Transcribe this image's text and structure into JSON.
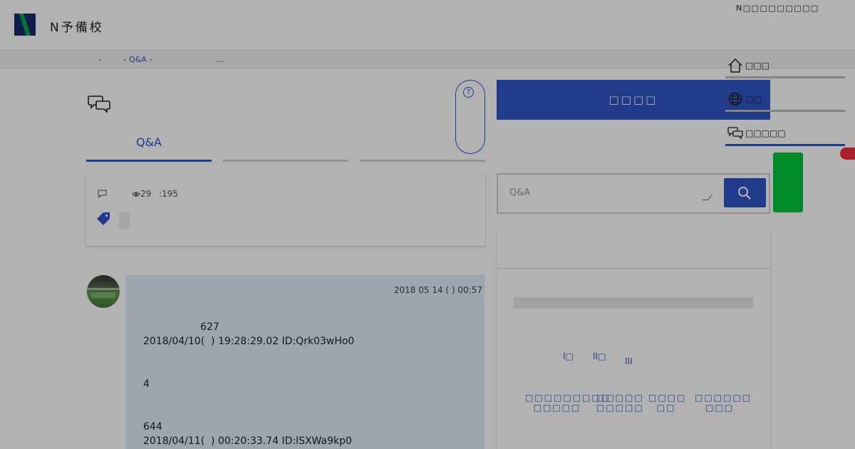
{
  "header": {
    "brand": "N予備校",
    "top_right_text": "N□□□□□□□□□"
  },
  "breadcrumb": {
    "sep1": "-",
    "sep2": "-",
    "link": "Q&A",
    "sep3": "-",
    "ellipsis": "..."
  },
  "help": {
    "icon_glyph": "?"
  },
  "tabs": [
    {
      "label": "Q&A",
      "active": true
    },
    {
      "label": "",
      "active": false
    },
    {
      "label": "",
      "active": false
    }
  ],
  "question_card": {
    "views": "29",
    "count": ":195"
  },
  "post": {
    "date": "2018  05  14  (  ) 00:57",
    "lines": [
      "                  627",
      "2018/04/10(  ) 19:28:29.02 ID:Qrk03wHo0",
      "4",
      "644",
      "2018/04/11(  ) 00:20:33.74 ID:lSXWa9kp0"
    ]
  },
  "ask_button": {
    "label": "□□□□"
  },
  "search": {
    "placeholder": "Q&A"
  },
  "panel": {
    "levels": [
      "I□",
      "II□",
      "III"
    ],
    "categories": [
      {
        "line1": "□□□□□□□□□",
        "line2": "□□□□□"
      },
      {
        "line1": "□□□□□",
        "line2": "□□□□□"
      },
      {
        "line1": "□□□□",
        "line2": "□□"
      },
      {
        "line1": "□□□□□□",
        "line2": "□□□"
      }
    ]
  },
  "side_nav": [
    {
      "label": "□□□",
      "icon": "home-icon"
    },
    {
      "label": "□□",
      "icon": "globe-icon"
    },
    {
      "label": "□□□□□",
      "icon": "chat-icon"
    }
  ],
  "colors": {
    "accent": "#2f55c4",
    "green": "#00c43f",
    "red": "#f42d3d",
    "post_bg": "#e3ecf9"
  }
}
